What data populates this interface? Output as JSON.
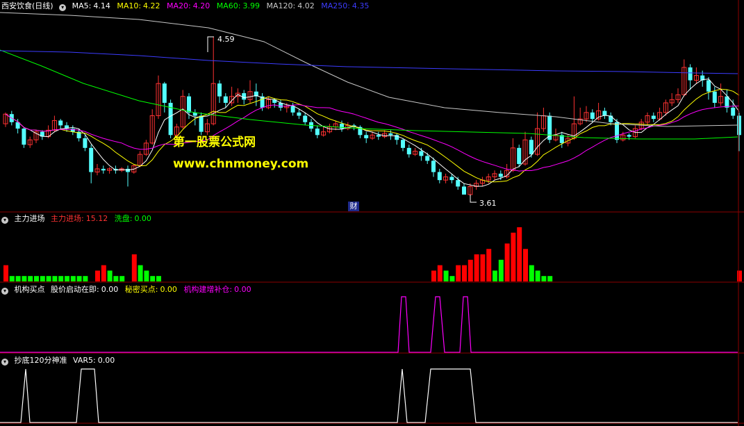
{
  "panel_main": {
    "title": "西安饮食(日线)",
    "ma5_label": "MA5:",
    "ma5_value": "4.14",
    "ma10_label": "MA10:",
    "ma10_value": "4.22",
    "ma20_label": "MA20:",
    "ma20_value": "4.20",
    "ma60_label": "MA60:",
    "ma60_value": "3.99",
    "ma120_label": "MA120:",
    "ma120_value": "4.02",
    "ma250_label": "MA250:",
    "ma250_value": "4.35",
    "high_label": "4.59",
    "low_label": "3.61",
    "watermark_title": "第一股票公式网",
    "watermark_url": "www.chnmoney.com",
    "marker_label": "财"
  },
  "panel_force": {
    "title": "主力进场",
    "main_label": "主力进场:",
    "main_value": "15.12",
    "wash_label": "洗盘:",
    "wash_value": "0.00"
  },
  "panel_buy": {
    "title": "机构买点",
    "start_label": "股价启动在即:",
    "start_value": "0.00",
    "secret_label": "秘密买点:",
    "secret_value": "0.00",
    "build_label": "机构建增补仓:",
    "build_value": "0.00"
  },
  "panel_bottom": {
    "title": "抄底120分神准",
    "var5_label": "VAR5:",
    "var5_value": "0.00"
  },
  "colors": {
    "up": "#ff3232",
    "down": "#54ffff",
    "ma5": "#ffffff",
    "ma10": "#ffff00",
    "ma20": "#ff00ff",
    "ma60": "#00ff00",
    "ma120": "#c8c8c8",
    "ma250": "#3c3cff",
    "force": "#ff0000",
    "wash": "#00ff00",
    "buy": "#ff00ff",
    "bottom": "#ffffff",
    "divider": "#8b0000"
  },
  "chart_data": {
    "type": "candlestick",
    "price_high": 4.59,
    "price_low": 3.61,
    "candles": [
      [
        4.05,
        4.11,
        4.12,
        4.03
      ],
      [
        4.11,
        4.06,
        4.13,
        4.04
      ],
      [
        4.06,
        4.02,
        4.08,
        3.99
      ],
      [
        4.02,
        3.92,
        4.03,
        3.9
      ],
      [
        3.92,
        3.95,
        3.97,
        3.9
      ],
      [
        3.95,
        4.0,
        4.01,
        3.93
      ],
      [
        4.0,
        3.97,
        4.01,
        3.95
      ],
      [
        3.97,
        4.01,
        4.04,
        3.96
      ],
      [
        4.01,
        4.07,
        4.1,
        4.0
      ],
      [
        4.07,
        4.04,
        4.08,
        4.02
      ],
      [
        4.04,
        4.02,
        4.06,
        4.0
      ],
      [
        4.02,
        4.0,
        4.04,
        3.98
      ],
      [
        4.0,
        3.96,
        4.02,
        3.94
      ],
      [
        3.96,
        3.9,
        3.98,
        3.88
      ],
      [
        3.9,
        3.75,
        3.92,
        3.68
      ],
      [
        3.75,
        3.77,
        3.8,
        3.73
      ],
      [
        3.77,
        3.76,
        3.79,
        3.74
      ],
      [
        3.76,
        3.77,
        3.78,
        3.74
      ],
      [
        3.77,
        3.76,
        3.79,
        3.74
      ],
      [
        3.76,
        3.77,
        3.78,
        3.75
      ],
      [
        3.77,
        3.75,
        3.79,
        3.66
      ],
      [
        3.75,
        3.79,
        3.8,
        3.74
      ],
      [
        3.79,
        3.86,
        3.88,
        3.78
      ],
      [
        3.86,
        3.93,
        3.95,
        3.85
      ],
      [
        3.93,
        4.1,
        4.14,
        3.92
      ],
      [
        4.1,
        4.3,
        4.35,
        4.08
      ],
      [
        4.3,
        4.18,
        4.31,
        4.12
      ],
      [
        4.18,
        3.98,
        4.2,
        3.96
      ],
      [
        3.98,
        4.03,
        4.05,
        3.97
      ],
      [
        4.03,
        4.22,
        4.26,
        4.02
      ],
      [
        4.22,
        4.12,
        4.24,
        4.08
      ],
      [
        4.12,
        4.1,
        4.14,
        4.04
      ],
      [
        4.1,
        4.0,
        4.12,
        3.98
      ],
      [
        4.0,
        4.05,
        4.08,
        3.98
      ],
      [
        4.05,
        4.3,
        4.59,
        4.04
      ],
      [
        4.3,
        4.22,
        4.32,
        4.18
      ],
      [
        4.22,
        4.18,
        4.24,
        4.15
      ],
      [
        4.18,
        4.22,
        4.28,
        4.16
      ],
      [
        4.22,
        4.24,
        4.27,
        4.18
      ],
      [
        4.24,
        4.2,
        4.26,
        4.17
      ],
      [
        4.2,
        4.25,
        4.32,
        4.18
      ],
      [
        4.25,
        4.22,
        4.3,
        4.16
      ],
      [
        4.22,
        4.15,
        4.24,
        4.13
      ],
      [
        4.15,
        4.2,
        4.22,
        4.14
      ],
      [
        4.2,
        4.18,
        4.21,
        4.15
      ],
      [
        4.18,
        4.15,
        4.2,
        4.13
      ],
      [
        4.15,
        4.16,
        4.18,
        4.12
      ],
      [
        4.16,
        4.12,
        4.18,
        4.1
      ],
      [
        4.12,
        4.1,
        4.14,
        4.08
      ],
      [
        4.1,
        4.06,
        4.12,
        4.04
      ],
      [
        4.06,
        4.02,
        4.08,
        4.0
      ],
      [
        4.02,
        3.98,
        4.04,
        3.96
      ],
      [
        3.98,
        4.0,
        4.03,
        3.97
      ],
      [
        4.0,
        4.03,
        4.05,
        3.99
      ],
      [
        4.03,
        4.05,
        4.07,
        4.01
      ],
      [
        4.05,
        4.02,
        4.07,
        4.0
      ],
      [
        4.02,
        4.04,
        4.06,
        4.01
      ],
      [
        4.04,
        4.03,
        4.05,
        4.01
      ],
      [
        4.03,
        3.98,
        4.04,
        3.96
      ],
      [
        3.98,
        3.96,
        4.0,
        3.93
      ],
      [
        3.96,
        3.98,
        4.0,
        3.95
      ],
      [
        3.98,
        3.97,
        4.0,
        3.95
      ],
      [
        3.97,
        3.99,
        4.01,
        3.96
      ],
      [
        3.99,
        3.98,
        4.01,
        3.95
      ],
      [
        3.98,
        3.95,
        3.99,
        3.92
      ],
      [
        3.95,
        3.9,
        3.96,
        3.88
      ],
      [
        3.9,
        3.86,
        3.92,
        3.84
      ],
      [
        3.86,
        3.88,
        3.9,
        3.85
      ],
      [
        3.88,
        3.85,
        3.9,
        3.82
      ],
      [
        3.85,
        3.82,
        3.87,
        3.8
      ],
      [
        3.82,
        3.75,
        3.84,
        3.72
      ],
      [
        3.75,
        3.7,
        3.77,
        3.68
      ],
      [
        3.7,
        3.72,
        3.74,
        3.68
      ],
      [
        3.72,
        3.7,
        3.74,
        3.68
      ],
      [
        3.7,
        3.66,
        3.72,
        3.64
      ],
      [
        3.66,
        3.61,
        3.68,
        3.61
      ],
      [
        3.61,
        3.66,
        3.68,
        3.6
      ],
      [
        3.66,
        3.68,
        3.7,
        3.64
      ],
      [
        3.68,
        3.7,
        3.72,
        3.66
      ],
      [
        3.7,
        3.72,
        3.74,
        3.68
      ],
      [
        3.72,
        3.74,
        3.76,
        3.7
      ],
      [
        3.74,
        3.72,
        3.76,
        3.7
      ],
      [
        3.72,
        3.76,
        3.8,
        3.71
      ],
      [
        3.76,
        3.9,
        3.96,
        3.75
      ],
      [
        3.9,
        3.8,
        3.92,
        3.78
      ],
      [
        3.8,
        3.95,
        4.0,
        3.79
      ],
      [
        3.95,
        3.86,
        3.97,
        3.84
      ],
      [
        3.86,
        4.02,
        4.12,
        3.85
      ],
      [
        4.02,
        4.1,
        4.15,
        4.0
      ],
      [
        4.1,
        3.95,
        4.12,
        3.93
      ],
      [
        3.95,
        3.98,
        4.02,
        3.94
      ],
      [
        3.98,
        3.93,
        4.0,
        3.9
      ],
      [
        3.93,
        3.96,
        3.98,
        3.91
      ],
      [
        3.96,
        4.05,
        4.22,
        3.95
      ],
      [
        4.05,
        4.08,
        4.15,
        4.04
      ],
      [
        4.08,
        4.12,
        4.16,
        4.06
      ],
      [
        4.12,
        4.08,
        4.14,
        4.06
      ],
      [
        4.08,
        4.13,
        4.18,
        4.07
      ],
      [
        4.13,
        4.1,
        4.15,
        4.08
      ],
      [
        4.1,
        4.06,
        4.12,
        4.04
      ],
      [
        4.06,
        3.95,
        4.08,
        3.93
      ],
      [
        3.95,
        3.98,
        4.0,
        3.94
      ],
      [
        3.98,
        3.97,
        3.99,
        3.95
      ],
      [
        3.97,
        4.02,
        4.04,
        3.96
      ],
      [
        4.02,
        4.06,
        4.08,
        4.01
      ],
      [
        4.06,
        4.1,
        4.12,
        4.04
      ],
      [
        4.1,
        4.08,
        4.12,
        4.06
      ],
      [
        4.08,
        4.12,
        4.15,
        4.07
      ],
      [
        4.12,
        4.18,
        4.2,
        4.1
      ],
      [
        4.18,
        4.2,
        4.24,
        4.16
      ],
      [
        4.2,
        4.23,
        4.27,
        4.18
      ],
      [
        4.23,
        4.4,
        4.45,
        4.22
      ],
      [
        4.4,
        4.32,
        4.42,
        4.26
      ],
      [
        4.32,
        4.35,
        4.4,
        4.3
      ],
      [
        4.35,
        4.32,
        4.38,
        4.28
      ],
      [
        4.32,
        4.25,
        4.34,
        4.2
      ],
      [
        4.25,
        4.18,
        4.28,
        4.15
      ],
      [
        4.18,
        4.22,
        4.3,
        4.16
      ],
      [
        4.22,
        4.15,
        4.26,
        4.12
      ],
      [
        4.15,
        4.1,
        4.2,
        4.08
      ],
      [
        4.1,
        3.98,
        4.12,
        3.88
      ]
    ],
    "force_values": [
      3,
      1,
      1,
      1,
      1,
      1,
      1,
      1,
      1,
      1,
      1,
      1,
      1,
      1,
      0,
      2,
      3,
      2,
      1,
      1,
      0,
      5,
      3,
      2,
      1,
      1,
      0,
      0,
      0,
      0,
      0,
      0,
      0,
      0,
      0,
      0,
      0,
      0,
      0,
      0,
      0,
      0,
      0,
      0,
      0,
      0,
      0,
      0,
      0,
      0,
      0,
      0,
      0,
      0,
      0,
      0,
      0,
      0,
      0,
      0,
      0,
      0,
      0,
      0,
      0,
      0,
      0,
      0,
      0,
      0,
      2,
      3,
      2,
      1,
      3,
      3,
      4,
      5,
      5,
      6,
      2,
      4,
      7,
      9,
      10,
      6,
      3,
      2,
      1,
      1,
      0,
      0,
      0,
      0,
      0,
      0,
      0,
      0,
      0,
      0,
      0,
      0,
      0,
      0,
      0,
      0,
      0,
      0,
      0,
      0,
      0,
      0,
      0,
      0,
      0,
      0,
      0,
      0,
      0,
      0,
      2
    ],
    "force_type": [
      1,
      0,
      0,
      0,
      0,
      0,
      0,
      0,
      0,
      0,
      0,
      0,
      0,
      0,
      0,
      1,
      1,
      0,
      0,
      0,
      0,
      1,
      0,
      0,
      0,
      0,
      0,
      0,
      0,
      0,
      0,
      0,
      0,
      0,
      0,
      0,
      0,
      0,
      0,
      0,
      0,
      0,
      0,
      0,
      0,
      0,
      0,
      0,
      0,
      0,
      0,
      0,
      0,
      0,
      0,
      0,
      0,
      0,
      0,
      0,
      0,
      0,
      0,
      0,
      0,
      0,
      0,
      0,
      0,
      0,
      1,
      1,
      0,
      0,
      1,
      1,
      1,
      1,
      1,
      1,
      0,
      0,
      1,
      1,
      1,
      1,
      0,
      0,
      0,
      0,
      0,
      0,
      0,
      0,
      0,
      0,
      0,
      0,
      0,
      0,
      0,
      0,
      0,
      0,
      0,
      0,
      0,
      0,
      0,
      0,
      0,
      0,
      0,
      0,
      0,
      0,
      0,
      0,
      0,
      0,
      1
    ],
    "buy_peaks": [
      [
        573,
        578,
        583
      ],
      [
        620,
        627,
        634
      ],
      [
        662,
        667,
        672
      ]
    ],
    "bottom_peaks": [
      [
        30,
        37,
        43
      ],
      [
        110,
        117,
        136,
        142
      ],
      [
        572,
        579,
        586
      ],
      [
        612,
        620,
        677,
        685
      ]
    ]
  }
}
